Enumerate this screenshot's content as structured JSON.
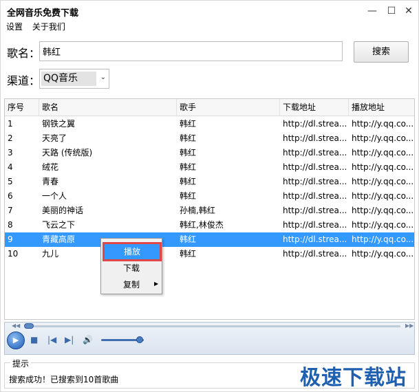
{
  "window": {
    "title": "全网音乐免费下载"
  },
  "window_controls": {
    "minimize": "—",
    "maximize": "☐",
    "close": "✕"
  },
  "menu": {
    "items": [
      "设置",
      "关于我们"
    ]
  },
  "search": {
    "label": "歌名：",
    "value": "韩红",
    "button": "搜索"
  },
  "channel": {
    "label": "渠道：",
    "value": "QQ音乐",
    "chevron": "⌄"
  },
  "table": {
    "headers": [
      "序号",
      "歌名",
      "歌手",
      "下载地址",
      "播放地址"
    ],
    "rows": [
      [
        "1",
        "钢铁之翼",
        "韩红",
        "http://dl.strea...",
        "http://y.qq.co..."
      ],
      [
        "2",
        "天亮了",
        "韩红",
        "http://dl.strea...",
        "http://y.qq.co..."
      ],
      [
        "3",
        "天路 (传统版)",
        "韩红",
        "http://dl.strea...",
        "http://y.qq.co..."
      ],
      [
        "4",
        "绒花",
        "韩红",
        "http://dl.strea...",
        "http://y.qq.co..."
      ],
      [
        "5",
        "青春",
        "韩红",
        "http://dl.strea...",
        "http://y.qq.co..."
      ],
      [
        "6",
        "一个人",
        "韩红",
        "http://dl.strea...",
        "http://y.qq.co..."
      ],
      [
        "7",
        "美丽的神话",
        "孙楠,韩红",
        "http://dl.strea...",
        "http://y.qq.co..."
      ],
      [
        "8",
        "飞云之下",
        "韩红,林俊杰",
        "http://dl.strea...",
        "http://y.qq.co..."
      ],
      [
        "9",
        "青藏高原",
        "韩红",
        "http://dl.strea...",
        "http://y.qq.co..."
      ],
      [
        "10",
        "九儿",
        "韩红",
        "http://dl.strea...",
        "http://y.qq.co..."
      ]
    ],
    "selected_row": 9
  },
  "context_menu": {
    "play": "播放",
    "download": "下载",
    "copy": "复制",
    "submenu_arrow": "▶"
  },
  "player": {
    "seek_left": "◀◀",
    "seek_right": "▶▶",
    "play": "▶",
    "stop": "■",
    "prev": "|◀",
    "next": "▶|",
    "volume": "🔊",
    "volume_level": 0.9,
    "position": 0.0
  },
  "status": {
    "title": "提示",
    "message": "搜索成功！已搜索到10首歌曲"
  },
  "watermark": {
    "text": "极速下载站"
  },
  "colors": {
    "selection": "#3399ff",
    "highlight_border": "#e04848",
    "watermark": "#1f5faf"
  }
}
